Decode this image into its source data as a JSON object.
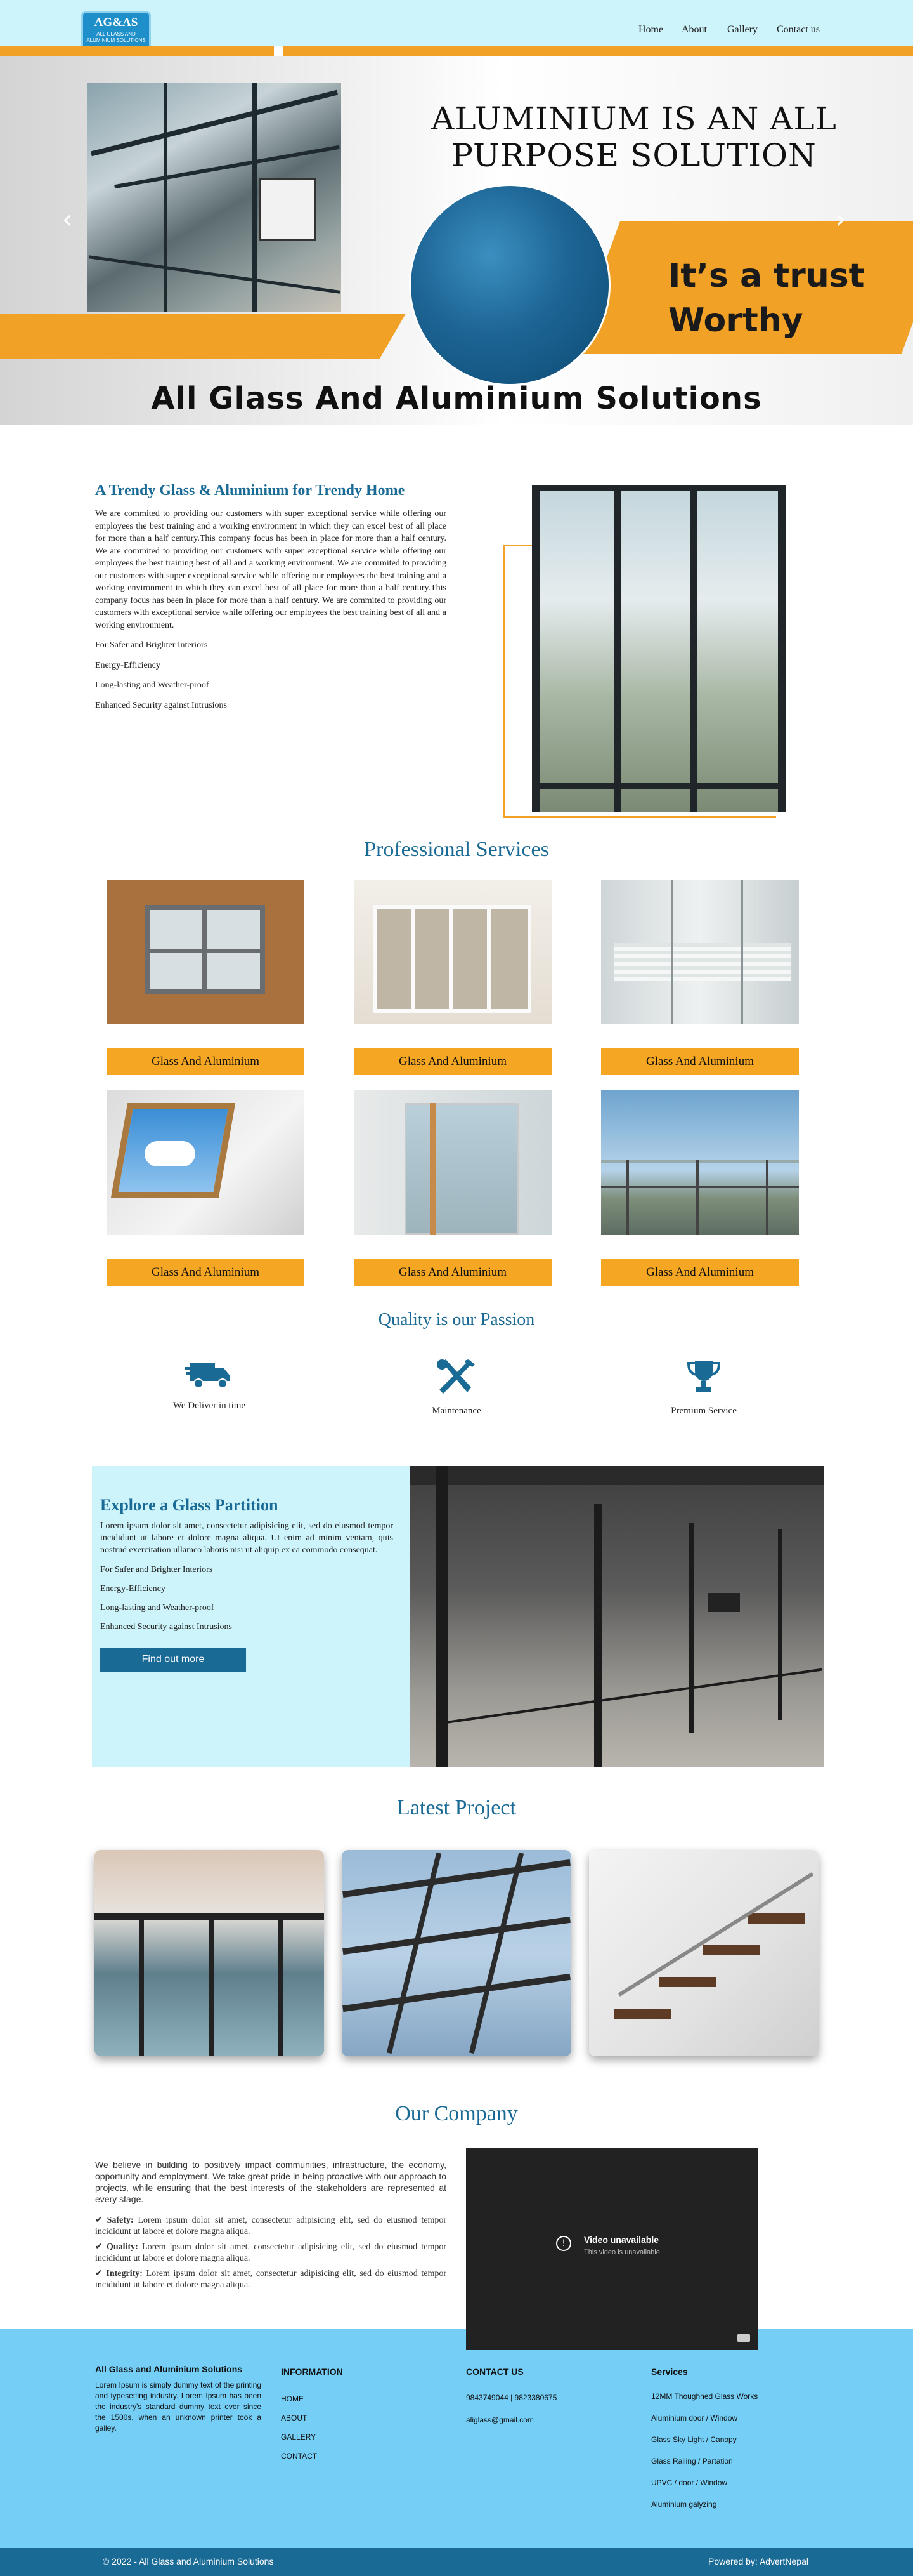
{
  "header": {
    "logo_text": "AG&AS",
    "logo_sub": "ALL GLASS AND ALUMINIUM SOLUTIONS",
    "nav": [
      "Home",
      "About",
      "Gallery",
      "Contact us"
    ]
  },
  "hero": {
    "title": "ALUMINIUM IS AN ALL PURPOSE SOLUTION",
    "trust_line1": "It’s a trust",
    "trust_line2": "Worthy",
    "bottom": "All Glass And Aluminium Solutions",
    "prev_icon": "chevron-left-icon",
    "next_icon": "chevron-right-icon"
  },
  "about": {
    "heading": "A Trendy Glass & Aluminium for Trendy Home",
    "paragraph": "We are commited to providing our customers with super exceptional service while offering our employees the best training and a working environment in which they can excel best of all place for more than a half century.This company focus has been in place for more than a half century. We are commited to providing our customers with super exceptional service while offering our employees the best training best of all and a working environment. We are commited to providing our customers with super exceptional service while offering our employees the best training and a working environment in which they can excel best of all place for more than a half century.This company focus has been in place for more than a half century. We are commited to providing our customers with exceptional service while offering our employees the best training best of all and a working environment.",
    "features": [
      "For Safer and Brighter Interiors",
      "Energy-Efficiency",
      "Long-lasting and Weather-proof",
      "Enhanced Security against Intrusions"
    ]
  },
  "services": {
    "title": "Professional Services",
    "items": [
      {
        "label": "Glass And Aluminium"
      },
      {
        "label": "Glass And Aluminium"
      },
      {
        "label": "Glass And Aluminium"
      },
      {
        "label": "Glass And Aluminium"
      },
      {
        "label": "Glass And Aluminium"
      },
      {
        "label": "Glass And Aluminium"
      }
    ]
  },
  "quality": {
    "title": "Quality is our Passion",
    "items": [
      {
        "label": "We Deliver in time",
        "icon": "truck-icon"
      },
      {
        "label": "Maintenance",
        "icon": "tools-icon"
      },
      {
        "label": "Premium Service",
        "icon": "trophy-icon"
      }
    ]
  },
  "explore": {
    "heading": "Explore a Glass Partition",
    "paragraph": "Lorem ipsum dolor sit amet, consectetur adipisicing elit, sed do eiusmod tempor incididunt ut labore et dolore magna aliqua. Ut enim ad minim veniam, quis nostrud exercitation ullamco laboris nisi ut aliquip ex ea commodo consequat.",
    "features": [
      "For Safer and Brighter Interiors",
      "Energy-Efficiency",
      "Long-lasting and Weather-proof",
      "Enhanced Security against Intrusions"
    ],
    "button": "Find out more"
  },
  "projects": {
    "title": "Latest Project"
  },
  "company": {
    "title": "Our Company",
    "paragraph": "We believe in building to positively impact communities, infrastructure, the economy, opportunity and employment. We take great pride in being proactive with our approach to projects, while ensuring that the best interests of the stakeholders are represented at every stage.",
    "points": [
      {
        "check": "✔",
        "label": "Safety:",
        "text": "Lorem ipsum dolor sit amet, consectetur adipisicing elit, sed do eiusmod tempor incididunt ut labore et dolore magna aliqua."
      },
      {
        "check": "✔",
        "label": "Quality:",
        "text": "Lorem ipsum dolor sit amet, consectetur adipisicing elit, sed do eiusmod tempor incididunt ut labore et dolore magna aliqua."
      },
      {
        "check": "✔",
        "label": "Integrity:",
        "text": "Lorem ipsum dolor sit amet, consectetur adipisicing elit, sed do eiusmod tempor incididunt ut labore et dolore magna aliqua."
      }
    ],
    "video_title": "Video unavailable",
    "video_sub": "This video is unavailable"
  },
  "footer": {
    "about_heading": "All Glass and Aluminium Solutions",
    "about_text": "Lorem Ipsum is simply dummy text of the printing and typesetting industry. Lorem Ipsum has been the industry's standard dummy text ever since the 1500s, when an unknown printer took a galley.",
    "info_heading": "INFORMATION",
    "info_links": [
      "HOME",
      "ABOUT",
      "GALLERY",
      "CONTACT"
    ],
    "contact_heading": "CONTACT US",
    "phone": "9843749044 | 9823380675",
    "email": "aliglass@gmail.com",
    "services_heading": "Services",
    "services": [
      "12MM Thoughned Glass Works",
      "Aluminium door / Window",
      "Glass Sky Light / Canopy",
      "Glass Railing / Partation",
      "UPVC / door / Window",
      "Aluminium galyzing"
    ],
    "copyright": "© 2022 - All Glass and Aluminium Solutions",
    "powered": "Powered by: AdvertNepal"
  }
}
